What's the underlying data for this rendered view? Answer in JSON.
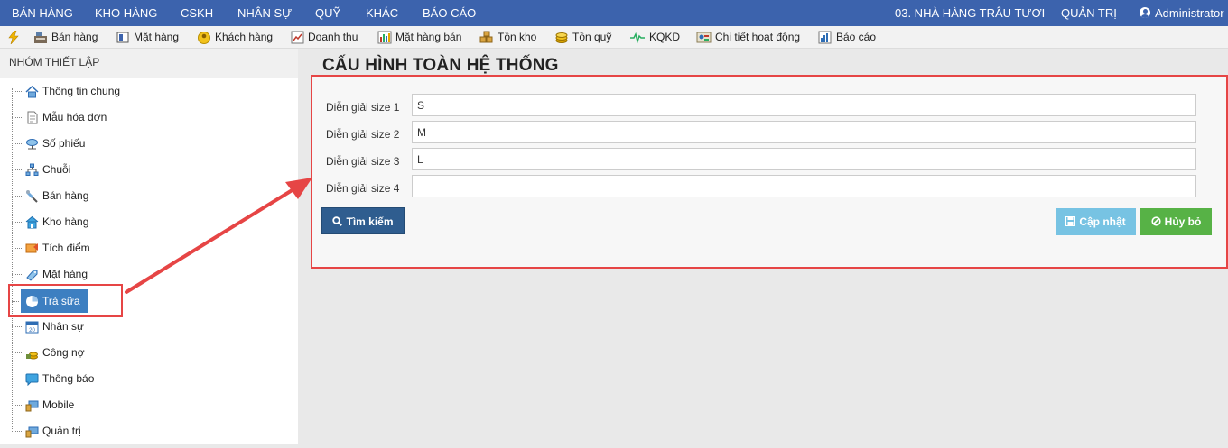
{
  "topnav": {
    "menu": [
      "BÁN HÀNG",
      "KHO HÀNG",
      "CSKH",
      "NHÂN SỰ",
      "QUỸ",
      "KHÁC",
      "BÁO CÁO"
    ],
    "store": "03. NHÀ HÀNG TRÂU TƯƠI",
    "admin": "QUẢN TRỊ",
    "user": "Administrator"
  },
  "toolbar": {
    "items": [
      "Bán hàng",
      "Mặt hàng",
      "Khách hàng",
      "Doanh thu",
      "Mặt hàng bán",
      "Tồn kho",
      "Tồn quỹ",
      "KQKD",
      "Chi tiết hoạt động",
      "Báo cáo"
    ]
  },
  "sidebar": {
    "header": "NHÓM THIẾT LẬP",
    "items": [
      "Thông tin chung",
      "Mẫu hóa đơn",
      "Số phiếu",
      "Chuỗi",
      "Bán hàng",
      "Kho hàng",
      "Tích điểm",
      "Mặt hàng",
      "Trà sữa",
      "Nhân sự",
      "Công nợ",
      "Thông báo",
      "Mobile",
      "Quản trị"
    ],
    "selected_index": 8
  },
  "content": {
    "title": "CẤU HÌNH TOÀN HỆ THỐNG",
    "fields": [
      {
        "label": "Diễn giải size 1",
        "value": "S"
      },
      {
        "label": "Diễn giải size 2",
        "value": "M"
      },
      {
        "label": "Diễn giải size 3",
        "value": "L"
      },
      {
        "label": "Diễn giải size 4",
        "value": ""
      }
    ],
    "search_button": "Tìm kiếm",
    "update_button": "Cập nhật",
    "cancel_button": "Hủy bỏ"
  },
  "colors": {
    "topnav_bg": "#3c63ad",
    "selected_bg": "#3d7fc1",
    "search_btn": "#2f5d8f",
    "update_btn": "#77c3e3",
    "cancel_btn": "#57b246",
    "annotation_red": "#e64545"
  }
}
